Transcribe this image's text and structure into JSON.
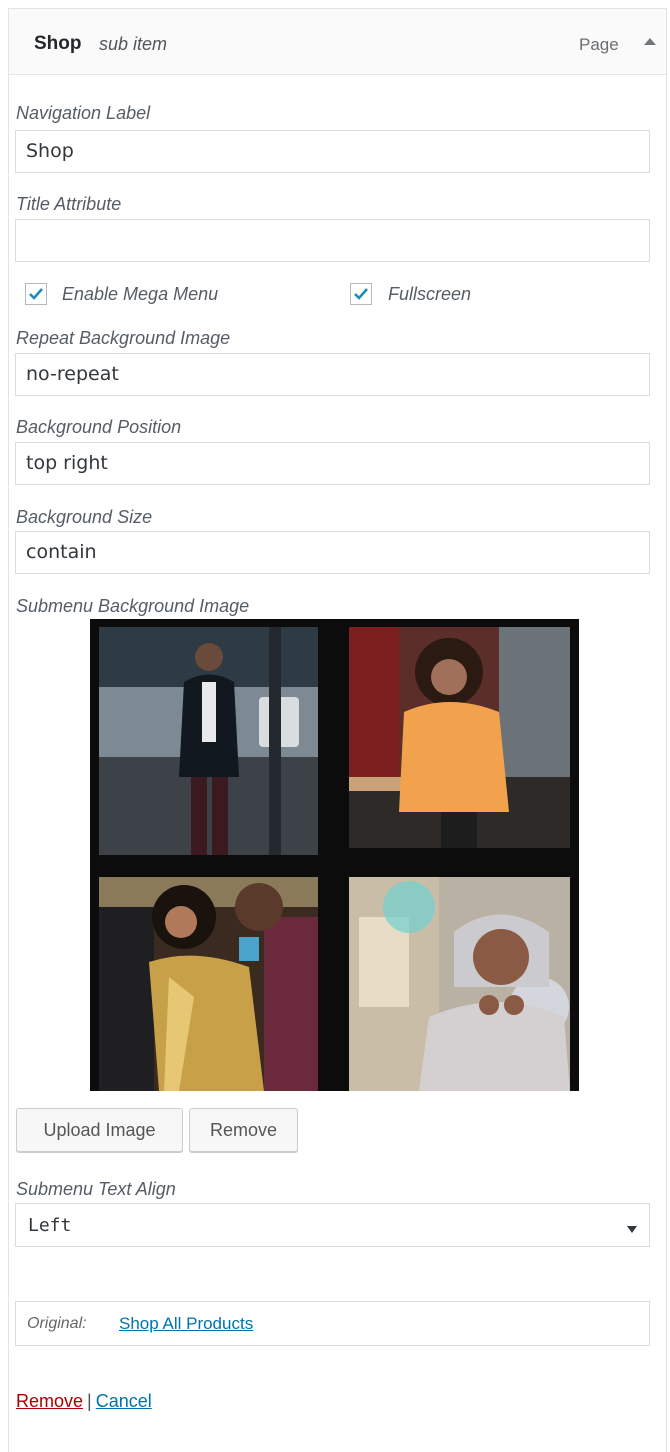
{
  "header": {
    "title": "Shop",
    "subtitle": "sub item",
    "type": "Page",
    "toggle_icon": "arrow-up-icon"
  },
  "fields": {
    "navigation_label": {
      "label": "Navigation Label",
      "value": "Shop"
    },
    "title_attribute": {
      "label": "Title Attribute",
      "value": ""
    },
    "enable_mega_menu": {
      "label": "Enable Mega Menu",
      "checked": true
    },
    "fullscreen": {
      "label": "Fullscreen",
      "checked": true
    },
    "repeat_bg": {
      "label": "Repeat Background Image",
      "value": "no-repeat"
    },
    "bg_position": {
      "label": "Background Position",
      "value": "top right"
    },
    "bg_size": {
      "label": "Background Size",
      "value": "contain"
    },
    "submenu_bg": {
      "label": "Submenu Background Image",
      "upload_label": "Upload Image",
      "remove_label": "Remove"
    },
    "text_align": {
      "label": "Submenu Text Align",
      "value": "Left"
    }
  },
  "original": {
    "label": "Original:",
    "link": "Shop All Products"
  },
  "actions": {
    "remove": "Remove",
    "separator": "|",
    "cancel": "Cancel"
  },
  "colors": {
    "link": "#0073aa",
    "delete": "#aa0000",
    "check": "#1e8cbe"
  }
}
